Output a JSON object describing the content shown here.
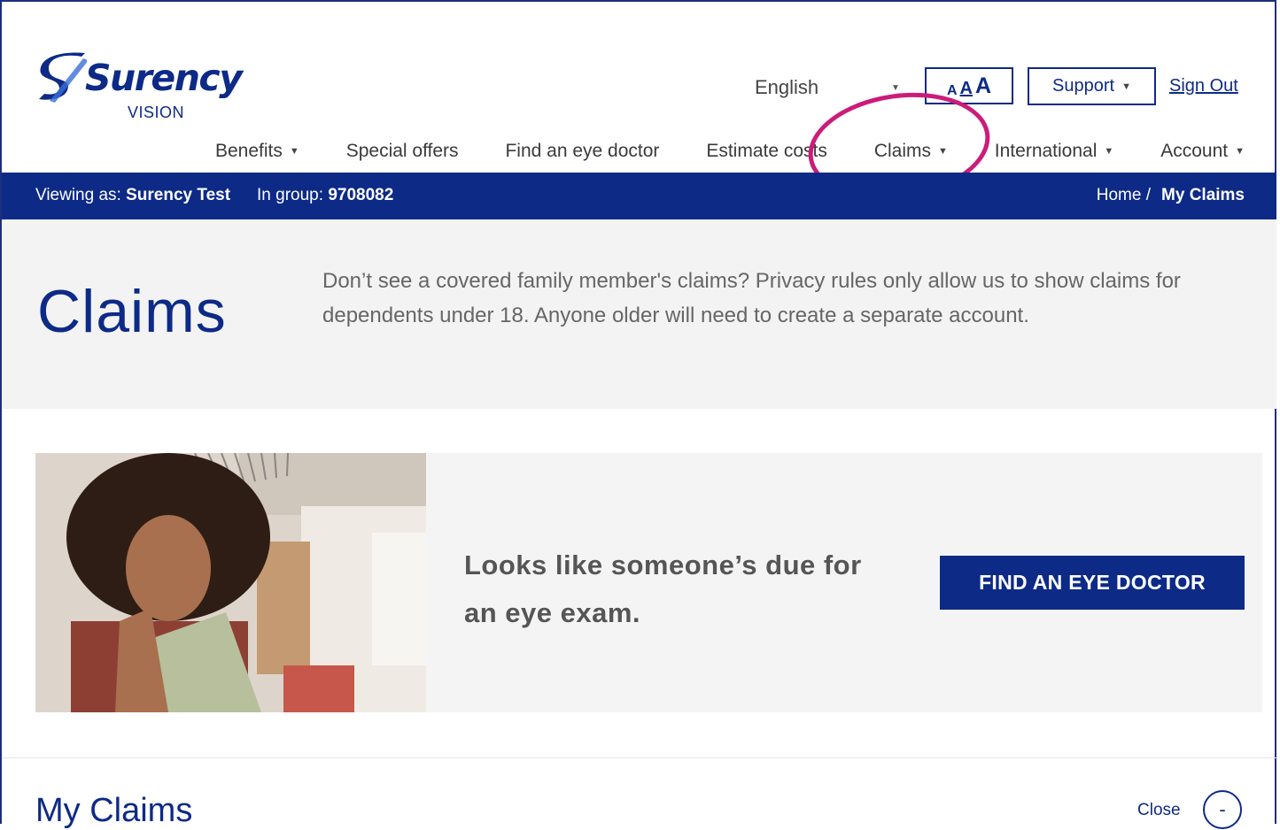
{
  "brand": {
    "name": "Surency",
    "sub": "VISION",
    "tm": ".",
    "color": "#0d2a87"
  },
  "utility": {
    "language": "English",
    "font_size_labels": [
      "A",
      "A",
      "A"
    ],
    "support_label": "Support",
    "sign_out_label": "Sign Out"
  },
  "nav": {
    "items": [
      {
        "label": "Benefits",
        "dropdown": true
      },
      {
        "label": "Special offers",
        "dropdown": false
      },
      {
        "label": "Find an eye doctor",
        "dropdown": false
      },
      {
        "label": "Estimate costs",
        "dropdown": false
      },
      {
        "label": "Claims",
        "dropdown": true
      },
      {
        "label": "International",
        "dropdown": true
      },
      {
        "label": "Account",
        "dropdown": true
      }
    ]
  },
  "annotation": {
    "highlight_color": "#cc1c7a"
  },
  "context_bar": {
    "viewing_label": "Viewing as:",
    "viewing_value": "Surency Test",
    "group_label": "In group:",
    "group_value": "9708082",
    "breadcrumb_home": "Home /",
    "breadcrumb_current": "My Claims"
  },
  "hero": {
    "title": "Claims",
    "text": "Don’t see a covered family member's claims? Privacy rules only allow us to show claims for dependents under 18. Anyone older will need to create a separate account."
  },
  "promo": {
    "line1": "Looks like someone’s due for",
    "line2": "an eye exam.",
    "button": "FIND AN EYE DOCTOR"
  },
  "my_claims": {
    "title": "My Claims",
    "close_label": "Close",
    "close_symbol": "-"
  }
}
